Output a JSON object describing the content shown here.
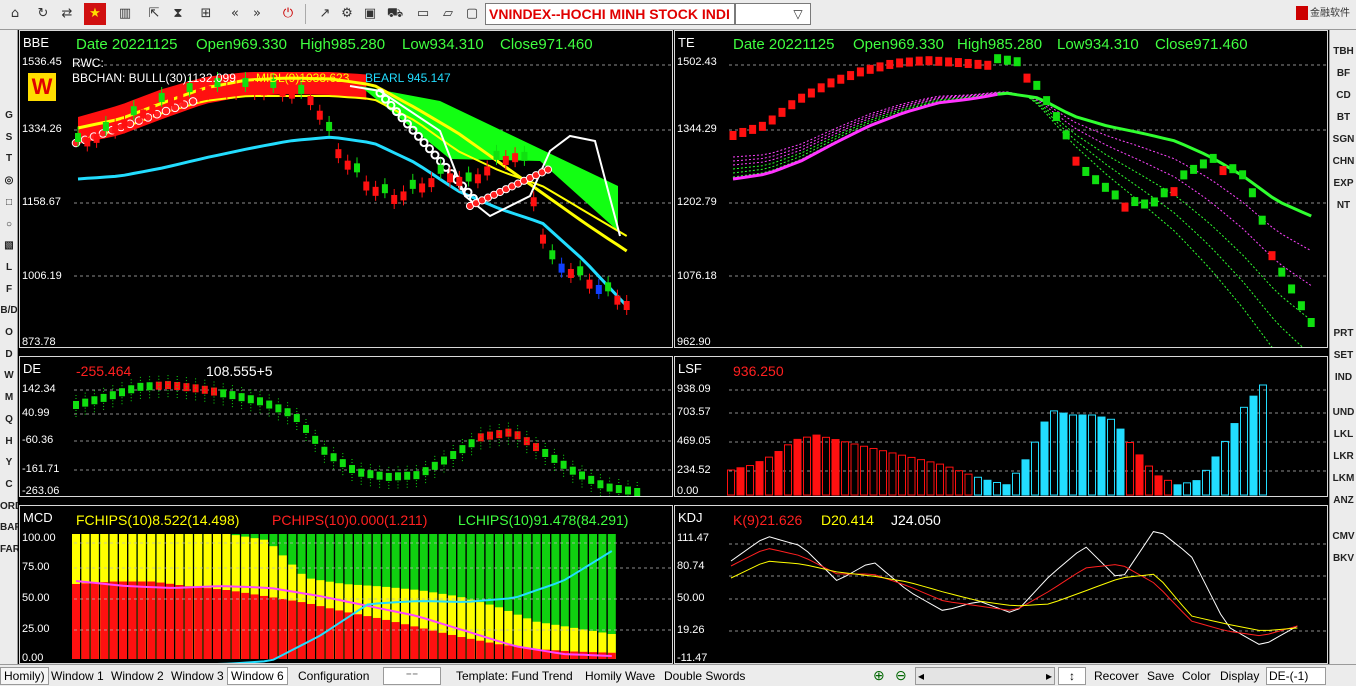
{
  "toolbar": {
    "stock_name": "VNINDEX--HOCHI MINH STOCK INDI",
    "brand": "金融软件"
  },
  "left_toolbar": [
    "G",
    "S",
    "T",
    "◎",
    "□",
    "○",
    "▧",
    "L",
    "F",
    "B/D",
    "O",
    "D",
    "W",
    "M",
    "Q",
    "H",
    "Y",
    "C",
    "ORD",
    "BAR",
    "FAR"
  ],
  "right_toolbar": [
    "TBH",
    "BF",
    "CD",
    "BT",
    "SGN",
    "CHN",
    "EXP",
    "NT",
    "UND",
    "LKL",
    "LKR",
    "LKM",
    "ANZ",
    "CMV",
    "BKV",
    "PRT",
    "SET",
    "IND"
  ],
  "main_panel": {
    "title": "BBE",
    "date": "Date 20221125",
    "open": "Open969.330",
    "high": "High985.280",
    "low": "Low934.310",
    "close": "Close971.460",
    "rwc_label": "RWC:",
    "w_badge": "W",
    "bbchan": "BBCHAN: BULLL(30)1132.099",
    "midl": "MIDL(9)1038.623",
    "bearl": "BEARL 945.147",
    "y_labels": [
      "1536.45",
      "1334.26",
      "1158.67",
      "1006.19",
      "873.78"
    ]
  },
  "te_panel": {
    "title": "TE",
    "date": "Date 20221125",
    "open": "Open969.330",
    "high": "High985.280",
    "low": "Low934.310",
    "close": "Close971.460",
    "y_labels": [
      "1502.43",
      "1344.29",
      "1202.79",
      "1076.18",
      "962.90"
    ]
  },
  "de_panel": {
    "title": "DE",
    "value1": "-255.464",
    "value2": "108.555+5",
    "y_labels": [
      "142.34",
      "40.99",
      "-60.36",
      "-161.71",
      "-263.06"
    ]
  },
  "lsf_panel": {
    "title": "LSF",
    "value": "936.250",
    "y_labels": [
      "938.09",
      "703.57",
      "469.05",
      "234.52",
      "0.00"
    ]
  },
  "mcd_panel": {
    "title": "MCD",
    "fchips": "FCHIPS(10)8.522(14.498)",
    "pchips": "PCHIPS(10)0.000(1.211)",
    "lchips": "LCHIPS(10)91.478(84.291)",
    "y_labels": [
      "100.00",
      "75.00",
      "50.00",
      "25.00",
      "0.00"
    ]
  },
  "kdj_panel": {
    "title": "KDJ",
    "k": "K(9)21.626",
    "d": "D20.414",
    "j": "J24.050",
    "y_labels": [
      "111.47",
      "80.74",
      "50.00",
      "19.26",
      "-11.47"
    ]
  },
  "statusbar": {
    "left_label": "Homily)",
    "tabs": [
      "Window 1",
      "Window 2",
      "Window 3",
      "Window 6",
      "Configuration"
    ],
    "template": "Template: Fund Trend",
    "items": [
      "Homily Wave",
      "Double Swords"
    ],
    "actions": [
      "Recover",
      "Save",
      "Color",
      "Display"
    ],
    "de_combo": "DE-(-1)"
  },
  "colors": {
    "up": "#ff1010",
    "down": "#10e010",
    "cyan": "#22ddff",
    "yellow": "#ffff00",
    "magenta": "#ff33ff"
  }
}
